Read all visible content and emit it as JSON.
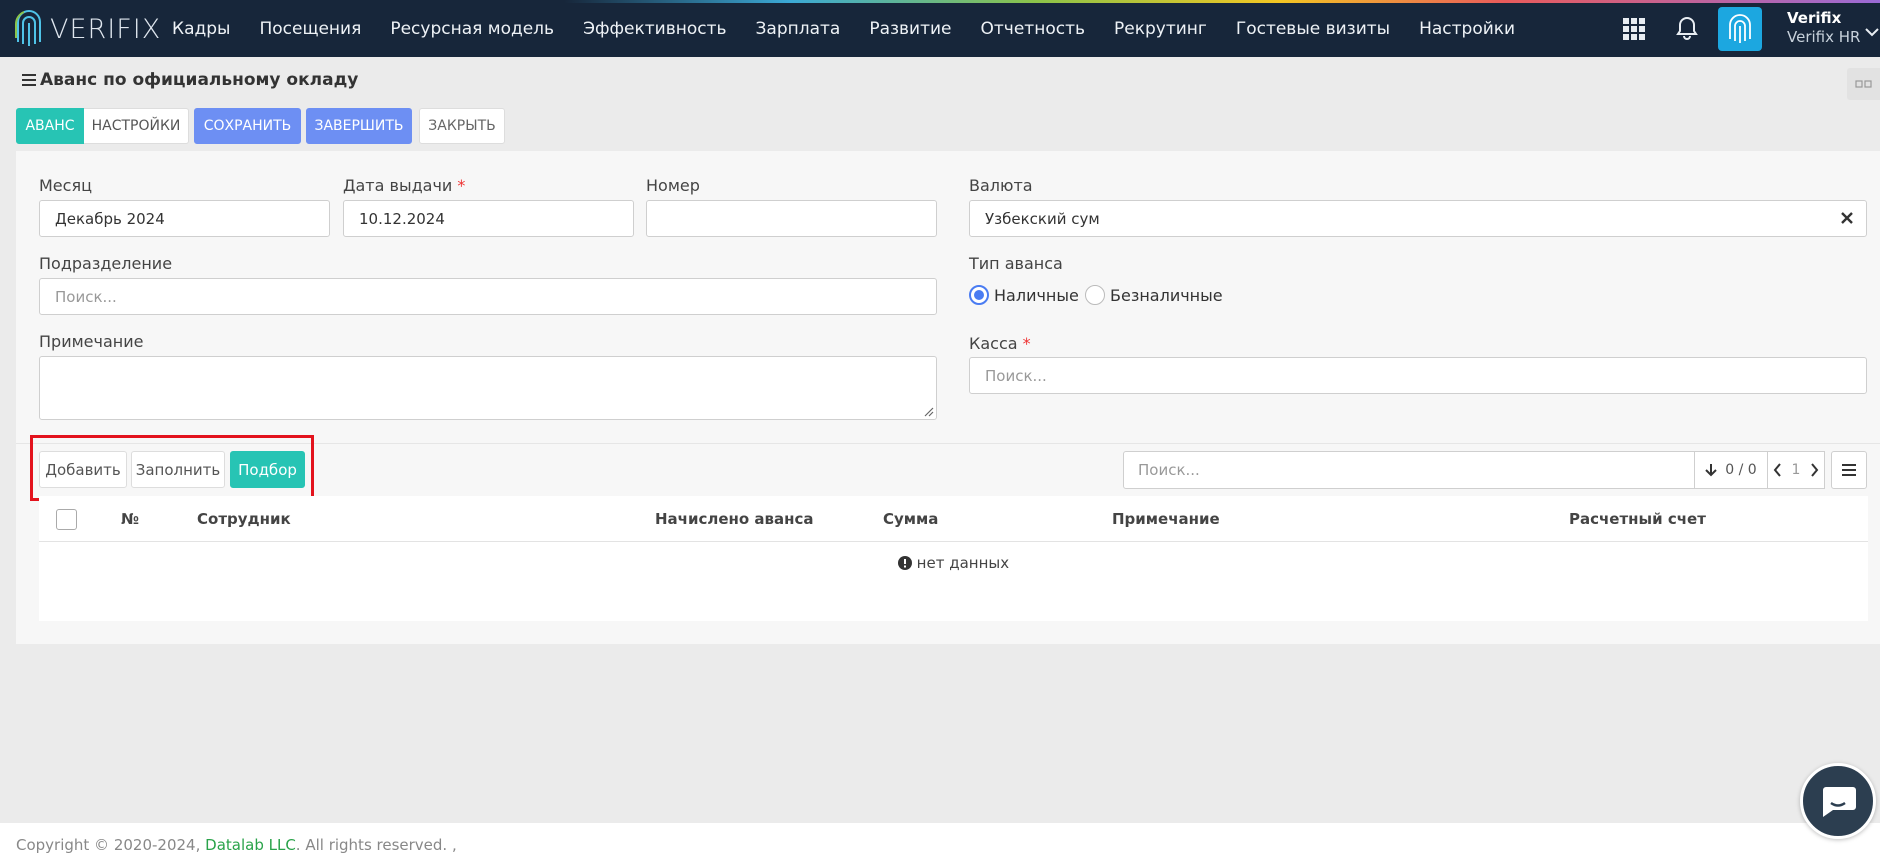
{
  "app": {
    "logo_text": "VERIFIX"
  },
  "nav": {
    "items": [
      "Кадры",
      "Посещения",
      "Ресурсная модель",
      "Эффективность",
      "Зарплата",
      "Развитие",
      "Отчетность",
      "Рекрутинг",
      "Гостевые визиты",
      "Настройки"
    ]
  },
  "user": {
    "name": "Verifix",
    "org": "Verifix HR"
  },
  "page": {
    "title": "Аванс по официальному окладу",
    "toolbar": {
      "tab_advance": "АВАНС",
      "tab_settings": "НАСТРОЙКИ",
      "save": "СОХРАНИТЬ",
      "finish": "ЗАВЕРШИТЬ",
      "close": "ЗАКРЫТЬ"
    }
  },
  "form": {
    "month": {
      "label": "Месяц",
      "value": "Декабрь 2024"
    },
    "issue_date": {
      "label": "Дата выдачи",
      "required": "*",
      "value": "10.12.2024"
    },
    "number": {
      "label": "Номер",
      "value": ""
    },
    "currency": {
      "label": "Валюта",
      "value": "Узбекский сум"
    },
    "division": {
      "label": "Подразделение",
      "placeholder": "Поиск..."
    },
    "advance_type": {
      "label": "Тип аванса",
      "options": [
        "Наличные",
        "Безналичные"
      ],
      "selected": "Наличные"
    },
    "note": {
      "label": "Примечание",
      "value": ""
    },
    "cash": {
      "label": "Касса",
      "required": "*",
      "placeholder": "Поиск..."
    }
  },
  "grid": {
    "buttons": {
      "add": "Добавить",
      "fill": "Заполнить",
      "pick": "Подбор"
    },
    "search_placeholder": "Поиск...",
    "count": "0 / 0",
    "page": "1",
    "columns": [
      "№",
      "Сотрудник",
      "Начислено аванса",
      "Сумма",
      "Примечание",
      "Расчетный счет"
    ],
    "empty": "нет данных"
  },
  "footer": {
    "prefix": "Copyright © 2020-2024,",
    "company": "Datalab LLC",
    "suffix": ". All rights reserved. ,"
  },
  "colors": {
    "nav_bg": "#17263a",
    "teal": "#27c4b4",
    "blue": "#6d8ff3",
    "highlight": "#e3131d"
  }
}
